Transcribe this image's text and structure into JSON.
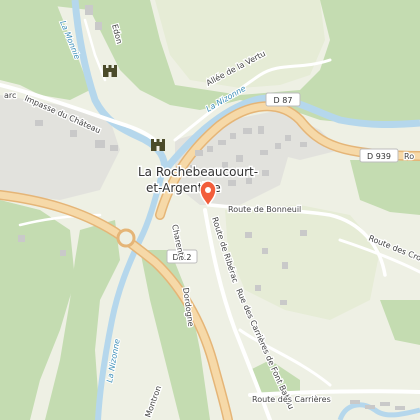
{
  "map": {
    "place_name_line1": "La Rochebeaucourt-",
    "place_name_line2": "et-Argentine",
    "road_labels": {
      "d87": "D 87",
      "d939": "D 939",
      "d939_tail": "Ro",
      "d12": "D 12",
      "route_bonneuil": "Route de Bonneuil",
      "route_riberac": "Route de Ribérac",
      "route_carrieres_font_babou": "Rue des Carrières de Font Babou",
      "route_carrieres": "Route des Carrières",
      "route_cros": "Route des Cros",
      "allee_vertu": "Allée de la Vertu",
      "impasse_chateau": "Impasse du Château",
      "edon": "Edon",
      "charente": "Charente",
      "dordogne": "Dordogne",
      "montron": "Montron",
      "arc": "arc"
    },
    "water_labels": {
      "la_monnie": "La Monnie",
      "la_nizonne_upper": "La Nizonne",
      "la_nizonne_lower": "La Nizonne"
    },
    "icons": {
      "marker": "location-pin",
      "castle": "castle-icon"
    },
    "colors": {
      "forest": "#c3dcb0",
      "meadow": "#eef0e4",
      "urban": "#e4e4e0",
      "river": "#b5d7ec",
      "primary_road": "#f6d9a8",
      "primary_road_casing": "#e5b577",
      "marker": "#f25d3b",
      "building": "#c9c9c9"
    }
  }
}
